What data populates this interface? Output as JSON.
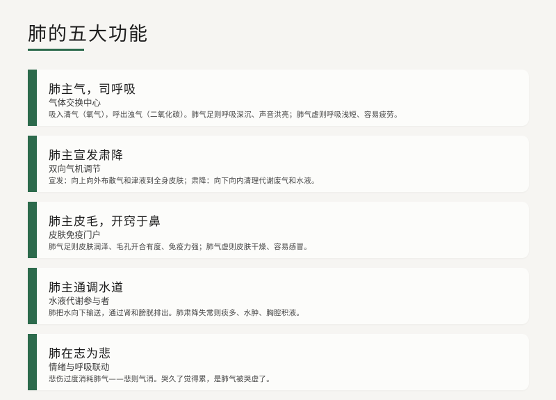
{
  "page": {
    "title": "肺的五大功能"
  },
  "cards": [
    {
      "title": "肺主气，司呼吸",
      "subtitle": "气体交换中心",
      "description": "吸入清气（氧气），呼出浊气（二氧化碳）。肺气足则呼吸深沉、声音洪亮；肺气虚则呼吸浅短、容易疲劳。"
    },
    {
      "title": "肺主宣发肃降",
      "subtitle": "双向气机调节",
      "description": "宣发：向上向外布散气和津液到全身皮肤；肃降：向下向内清理代谢废气和水液。"
    },
    {
      "title": "肺主皮毛，开窍于鼻",
      "subtitle": "皮肤免疫门户",
      "description": "肺气足则皮肤润泽、毛孔开合有度、免疫力强；肺气虚则皮肤干燥、容易感冒。"
    },
    {
      "title": "肺主通调水道",
      "subtitle": "水液代谢参与者",
      "description": "肺把水向下输送，通过肾和膀胱排出。肺肃降失常则痰多、水肿、胸腔积液。"
    },
    {
      "title": "肺在志为悲",
      "subtitle": "情绪与呼吸联动",
      "description": "悲伤过度消耗肺气——悲则气消。哭久了觉得累，是肺气被哭虚了。"
    }
  ]
}
